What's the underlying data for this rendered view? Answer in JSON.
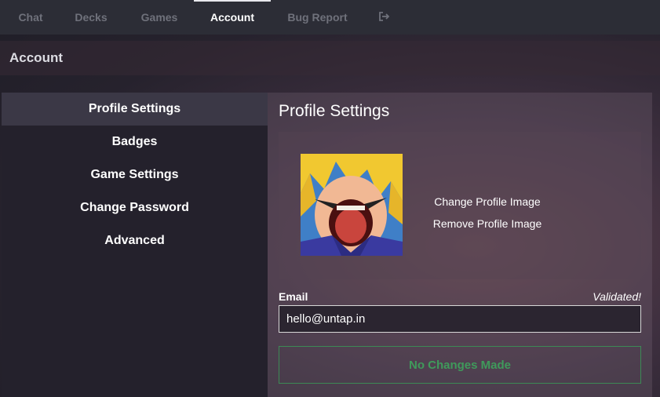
{
  "nav": {
    "items": [
      {
        "label": "Chat"
      },
      {
        "label": "Decks"
      },
      {
        "label": "Games"
      },
      {
        "label": "Account"
      },
      {
        "label": "Bug Report"
      }
    ],
    "active": "Account",
    "logout_icon": "logout-icon"
  },
  "header": {
    "title": "Account"
  },
  "sidebar": {
    "items": [
      {
        "label": "Profile Settings"
      },
      {
        "label": "Badges"
      },
      {
        "label": "Game Settings"
      },
      {
        "label": "Change Password"
      },
      {
        "label": "Advanced"
      }
    ],
    "active": "Profile Settings"
  },
  "profile": {
    "title": "Profile Settings",
    "change_image_label": "Change Profile Image",
    "remove_image_label": "Remove Profile Image",
    "email_label": "Email",
    "email_status": "Validated!",
    "email_value": "hello@untap.in",
    "save_label": "No Changes Made"
  },
  "colors": {
    "nav_bg": "#2c2d36",
    "sidebar_bg": "#24212c",
    "sidebar_active_bg": "#3b3846",
    "save_green": "#3f9a5b"
  }
}
